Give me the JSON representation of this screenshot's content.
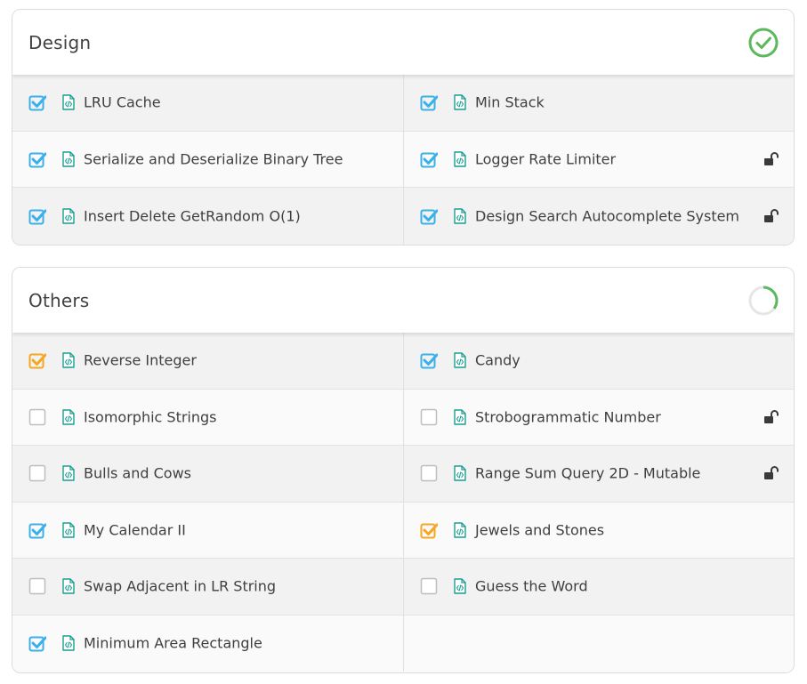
{
  "colors": {
    "checked_blue": "#3ab0ea",
    "checked_orange": "#f5a623",
    "file_teal": "#1a9e8f",
    "complete_green": "#5cb85c",
    "progress_track": "#e6e6e6"
  },
  "sections": [
    {
      "title": "Design",
      "status": "complete",
      "problems": [
        {
          "name": "LRU Cache",
          "state": "checked",
          "locked": false
        },
        {
          "name": "Min Stack",
          "state": "checked",
          "locked": false
        },
        {
          "name": "Serialize and Deserialize Binary Tree",
          "state": "checked",
          "locked": false
        },
        {
          "name": "Logger Rate Limiter",
          "state": "checked",
          "locked": true
        },
        {
          "name": "Insert Delete GetRandom O(1)",
          "state": "checked",
          "locked": false
        },
        {
          "name": "Design Search Autocomplete System",
          "state": "checked",
          "locked": true
        }
      ]
    },
    {
      "title": "Others",
      "status": "in-progress",
      "progress": 0.35,
      "problems": [
        {
          "name": "Reverse Integer",
          "state": "attempted",
          "locked": false
        },
        {
          "name": "Candy",
          "state": "checked",
          "locked": false
        },
        {
          "name": "Isomorphic Strings",
          "state": "unchecked",
          "locked": false
        },
        {
          "name": "Strobogrammatic Number",
          "state": "unchecked",
          "locked": true
        },
        {
          "name": "Bulls and Cows",
          "state": "unchecked",
          "locked": false
        },
        {
          "name": "Range Sum Query 2D - Mutable",
          "state": "unchecked",
          "locked": true
        },
        {
          "name": "My Calendar II",
          "state": "checked",
          "locked": false
        },
        {
          "name": "Jewels and Stones",
          "state": "attempted",
          "locked": false
        },
        {
          "name": "Swap Adjacent in LR String",
          "state": "unchecked",
          "locked": false
        },
        {
          "name": "Guess the Word",
          "state": "unchecked",
          "locked": false
        },
        {
          "name": "Minimum Area Rectangle",
          "state": "checked",
          "locked": false
        }
      ]
    }
  ],
  "icons": {
    "checkbox": "checkbox-icon",
    "file": "file-code-icon",
    "lock": "lock-open-icon",
    "complete": "check-circle-icon",
    "progress": "progress-ring-icon"
  }
}
